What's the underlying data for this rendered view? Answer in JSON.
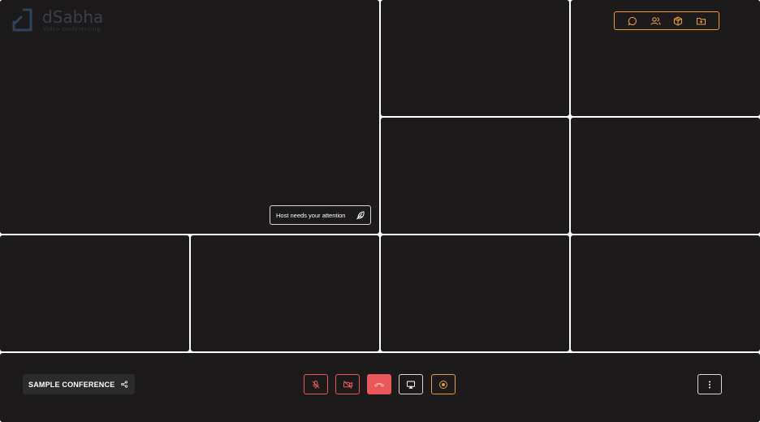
{
  "app": {
    "logo_name": "dSabha",
    "logo_subtitle": "Video conferencing"
  },
  "toolbar": {
    "items": [
      {
        "icon": "chat-icon"
      },
      {
        "icon": "participants-icon"
      },
      {
        "icon": "package-icon"
      },
      {
        "icon": "folder-icon"
      }
    ]
  },
  "notification": {
    "text": "Host needs your attention",
    "icon": "feather-icon"
  },
  "conference": {
    "name": "SAMPLE CONFERENCE",
    "share_icon": "share-icon"
  },
  "controls": [
    {
      "name": "mute-mic",
      "icon": "mic-off-icon",
      "state": "off"
    },
    {
      "name": "camera",
      "icon": "video-off-icon",
      "state": "off"
    },
    {
      "name": "hang-up",
      "icon": "phone-end-icon"
    },
    {
      "name": "screen-share",
      "icon": "monitor-icon"
    },
    {
      "name": "record",
      "icon": "record-icon"
    }
  ],
  "colors": {
    "background": "#1c1a1b",
    "accent_orange": "#e89a3c",
    "danger_red": "#e9575a",
    "gap": "#ffffff"
  }
}
